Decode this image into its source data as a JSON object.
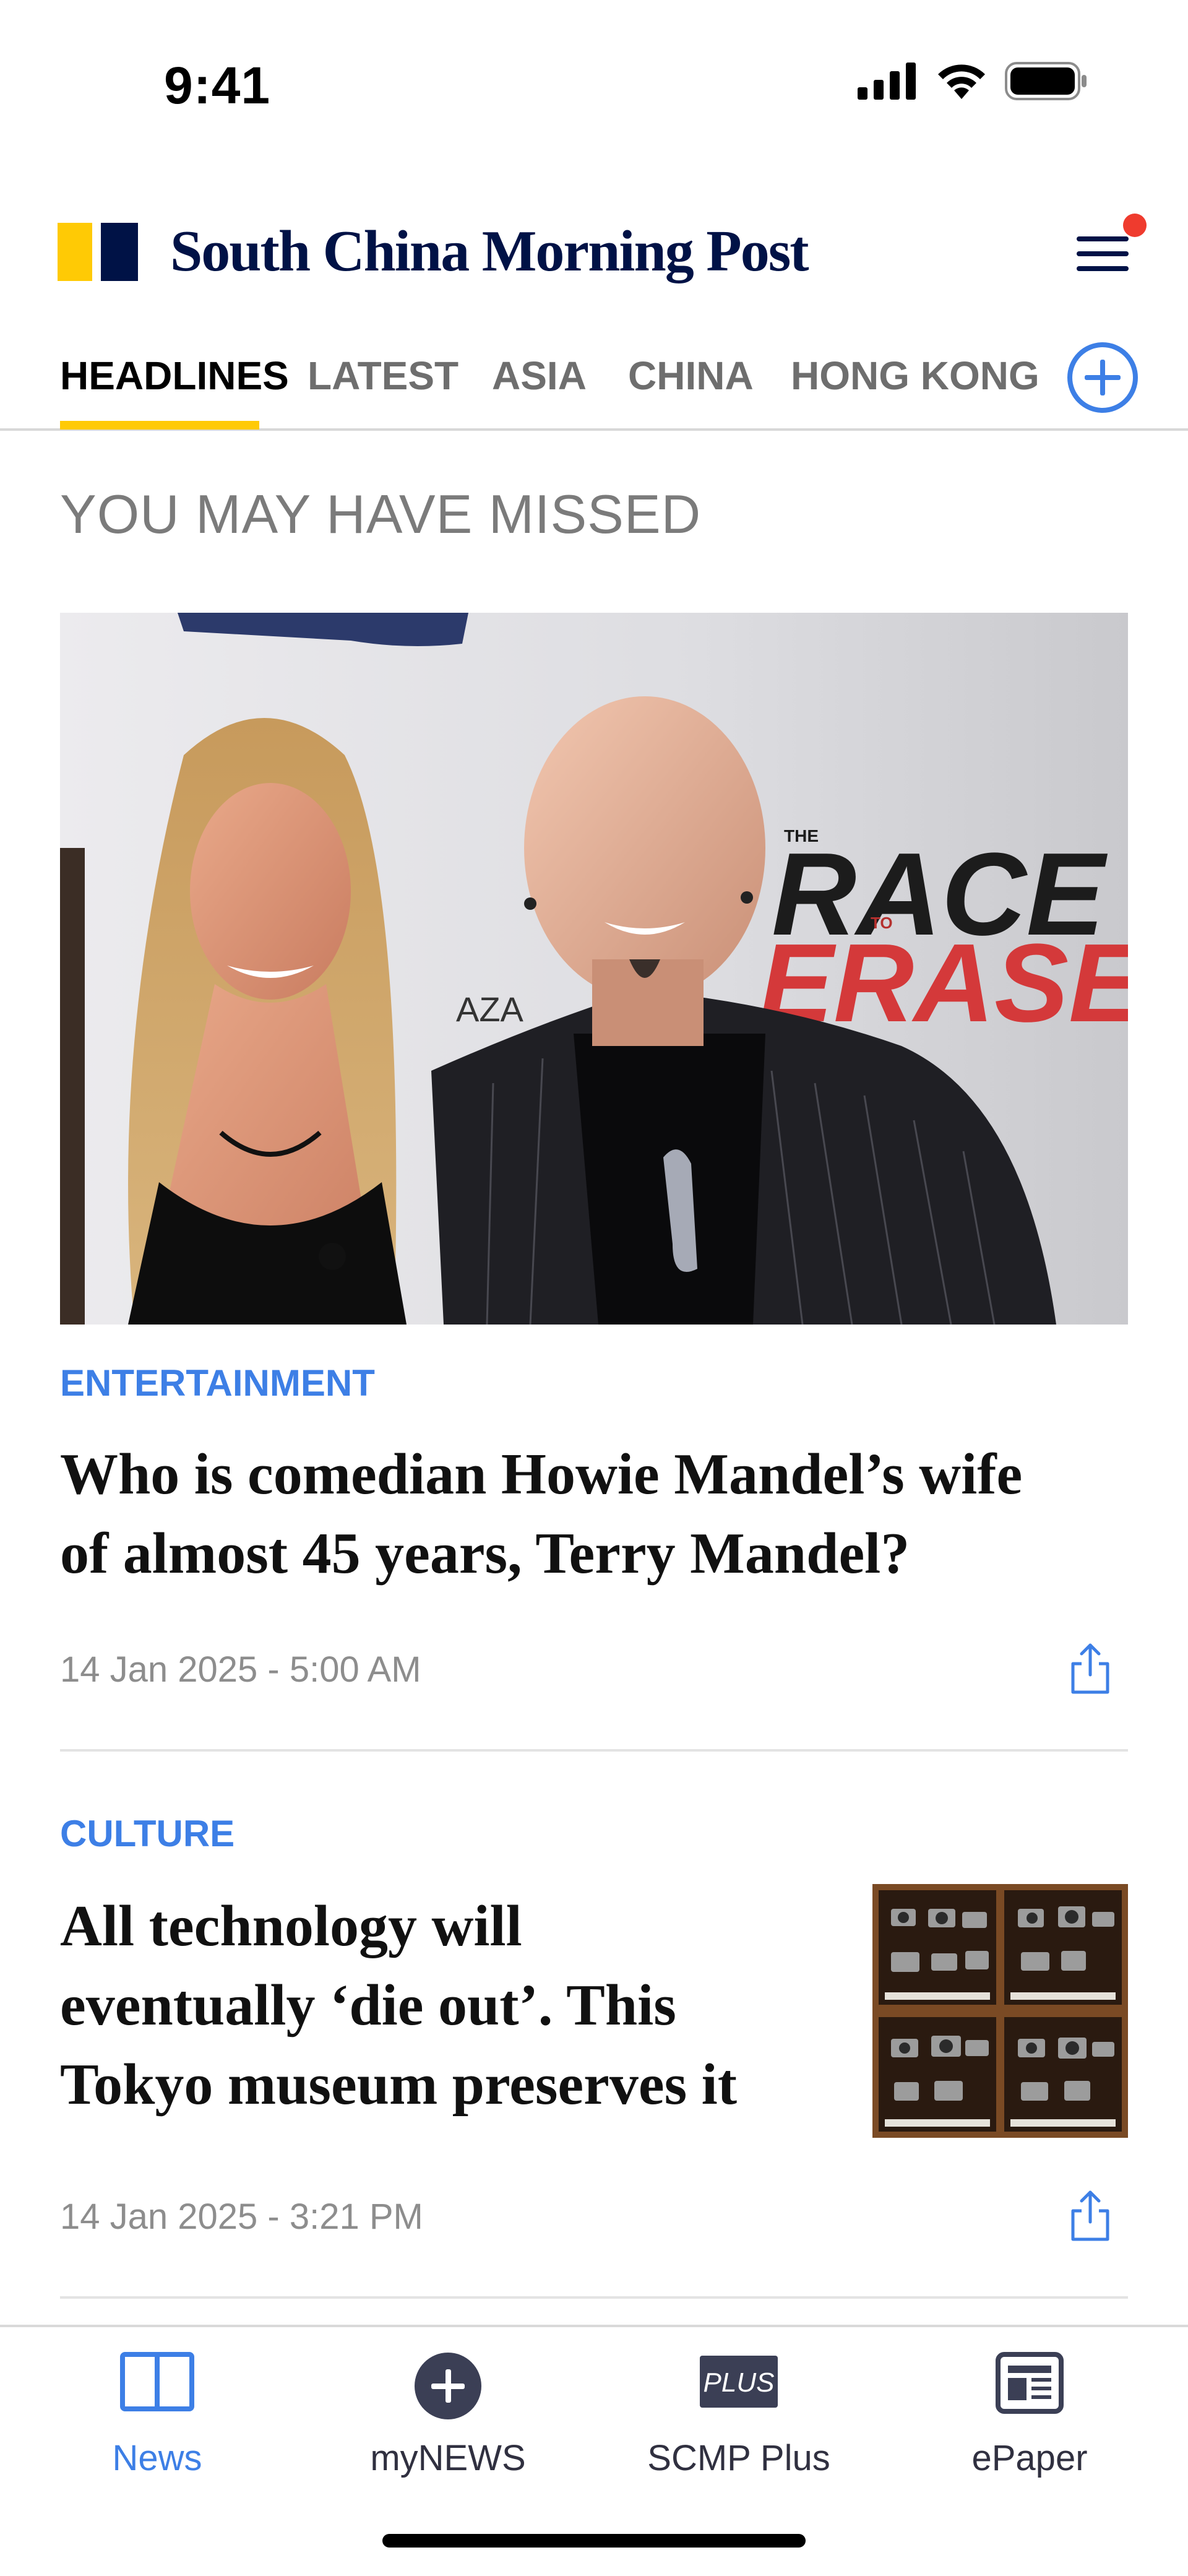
{
  "status_bar": {
    "time": "9:41"
  },
  "header": {
    "brand": "South China Morning Post",
    "notification_dot_color": "#EF3B2E"
  },
  "tabs": [
    {
      "label": "HEADLINES",
      "active": true
    },
    {
      "label": "LATEST",
      "active": false
    },
    {
      "label": "ASIA",
      "active": false
    },
    {
      "label": "CHINA",
      "active": false
    },
    {
      "label": "HONG KONG",
      "active": false
    }
  ],
  "section": {
    "title": "YOU MAY HAVE MISSED"
  },
  "articles": [
    {
      "category": "ENTERTAINMENT",
      "headline_line1": "Who is comedian Howie Mandel’s wife",
      "headline_line2": "of almost 45 years, Terry Mandel?",
      "timestamp": "14 Jan 2025 - 5:00 AM",
      "image_text": {
        "backdrop_the": "THE",
        "backdrop_race": "RACE",
        "backdrop_to": "TO",
        "backdrop_erase": "ERASE",
        "backdrop_aza": "AZA"
      }
    },
    {
      "category": "CULTURE",
      "headline_line1": "All technology will",
      "headline_line2": "eventually ‘die out’. This",
      "headline_line3": "Tokyo museum preserves it",
      "timestamp": "14 Jan 2025 - 3:21 PM"
    }
  ],
  "bottom_nav": [
    {
      "label": "News",
      "icon": "book-icon",
      "active": true
    },
    {
      "label": "myNEWS",
      "icon": "plus-circle-icon",
      "active": false
    },
    {
      "label": "SCMP Plus",
      "icon": "plus-badge-icon",
      "badge_text": "PLUS",
      "active": false
    },
    {
      "label": "ePaper",
      "icon": "newspaper-icon",
      "active": false
    }
  ],
  "colors": {
    "brand_navy": "#001246",
    "brand_yellow": "#FFCA05",
    "accent_blue": "#3D7FE6",
    "muted_text": "#8d8d8d"
  }
}
